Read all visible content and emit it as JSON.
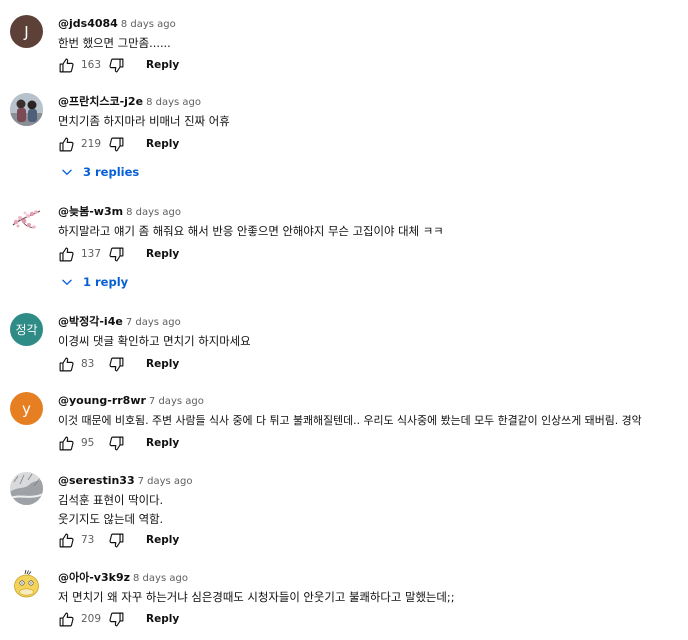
{
  "comments": [
    {
      "author": "@jds4084",
      "time": "8 days ago",
      "lines": [
        "한번 했으면 그만좀......"
      ],
      "likes": "163",
      "reply_label": "Reply",
      "avatar": {
        "type": "letter",
        "letter": "J",
        "color": "#5d4037"
      }
    },
    {
      "author": "@프란치스코-j2e",
      "time": "8 days ago",
      "lines": [
        "면치기좀 하지마라 비매너 진짜 어휴"
      ],
      "likes": "219",
      "reply_label": "Reply",
      "replies_label": "3 replies",
      "avatar": {
        "type": "photo-people"
      }
    },
    {
      "author": "@늦봄-w3m",
      "time": "8 days ago",
      "lines": [
        "하지말라고 얘기 좀 해줘요 해서 반응 안좋으면 안해야지 무슨 고집이야 대체 ㅋㅋ"
      ],
      "likes": "137",
      "reply_label": "Reply",
      "replies_label": "1 reply",
      "avatar": {
        "type": "photo-blossom"
      }
    },
    {
      "author": "@박정각-i4e",
      "time": "7 days ago",
      "lines": [
        "이경씨 댓글 확인하고 면치기 하지마세요"
      ],
      "likes": "83",
      "reply_label": "Reply",
      "avatar": {
        "type": "letter",
        "letter": "정각",
        "color": "#2e8b86"
      }
    },
    {
      "author": "@young-rr8wr",
      "time": "7 days ago",
      "lines": [
        "이것 때문에 비호됨. 주변 사람들 식사 중에 다 튀고 불쾌해질텐데.. 우리도 식사중에 봤는데 모두 한결같이 인상쓰게 돼버림. 경악"
      ],
      "likes": "95",
      "reply_label": "Reply",
      "avatar": {
        "type": "letter",
        "letter": "y",
        "color": "#e67e22"
      }
    },
    {
      "author": "@serestin33",
      "time": "7 days ago",
      "lines": [
        "김석훈 표현이 딱이다.",
        "웃기지도 않는데 역함."
      ],
      "likes": "73",
      "reply_label": "Reply",
      "avatar": {
        "type": "photo-snow"
      }
    },
    {
      "author": "@아아-v3k9z",
      "time": "8 days ago",
      "lines": [
        "저 면치기 왜 자꾸 하는거냐 심은경때도 시청자들이 안웃기고 불쾌하다고 말했는데;;"
      ],
      "likes": "209",
      "reply_label": "Reply",
      "avatar": {
        "type": "photo-duck"
      }
    }
  ],
  "icons": {
    "like": "thumbs-up-icon",
    "dislike": "thumbs-down-icon",
    "expand": "chevron-down-icon"
  },
  "colors": {
    "link": "#065fd4",
    "meta": "#606060",
    "text": "#0f0f0f"
  }
}
